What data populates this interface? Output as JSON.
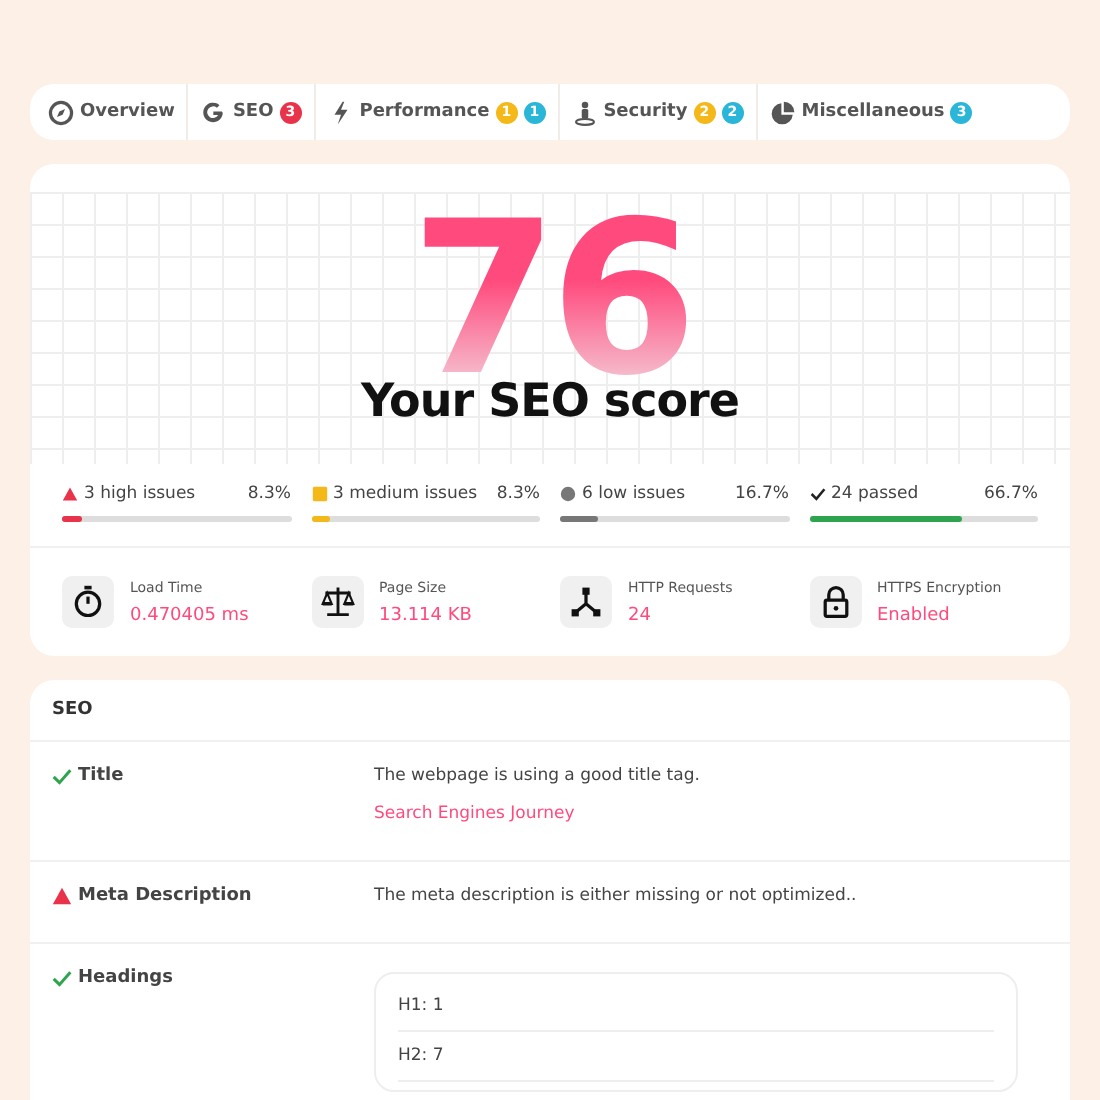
{
  "tabs": [
    {
      "label": "Overview",
      "selected": false
    },
    {
      "label": "SEO",
      "selected": false,
      "badges": [
        {
          "count": "3",
          "color": "#e8334a"
        }
      ]
    },
    {
      "label": "Performance",
      "selected": false,
      "badges": [
        {
          "count": "1",
          "color": "#f5b819"
        },
        {
          "count": "1",
          "color": "#29b6d8"
        }
      ]
    },
    {
      "label": "Security",
      "selected": false,
      "badges": [
        {
          "count": "2",
          "color": "#f5b819"
        },
        {
          "count": "2",
          "color": "#29b6d8"
        }
      ]
    },
    {
      "label": "Miscellaneous",
      "selected": false,
      "badges": [
        {
          "count": "3",
          "color": "#29b6d8"
        }
      ]
    }
  ],
  "score": {
    "value": "76",
    "caption": "Your SEO score"
  },
  "issues": [
    {
      "kind": "high",
      "label": "3 high issues",
      "percent": "8.3%",
      "level": 0.083
    },
    {
      "kind": "medium",
      "label": "3 medium issues",
      "percent": "8.3%",
      "level": 0.083
    },
    {
      "kind": "low",
      "label": "6 low issues",
      "percent": "16.7%",
      "level": 0.167
    },
    {
      "kind": "passed",
      "label": "24 passed",
      "percent": "66.7%",
      "level": 0.667
    }
  ],
  "stats": [
    {
      "label": "Load Time",
      "value": "0.470405 ms"
    },
    {
      "label": "Page Size",
      "value": "13.114 KB"
    },
    {
      "label": "HTTP Requests",
      "value": "24"
    },
    {
      "label": "HTTPS Encryption",
      "value": "Enabled"
    }
  ],
  "seo": {
    "title": "SEO",
    "rows": [
      {
        "kind": "passed",
        "name": "Title",
        "text": "The webpage is using a good title tag.",
        "detail": "Search Engines Journey"
      },
      {
        "kind": "high",
        "name": "Meta Description",
        "text": "The meta description is either missing or not optimized.."
      },
      {
        "kind": "passed",
        "name": "Headings",
        "headings": [
          "H1: 1",
          "H2: 7"
        ]
      }
    ]
  }
}
